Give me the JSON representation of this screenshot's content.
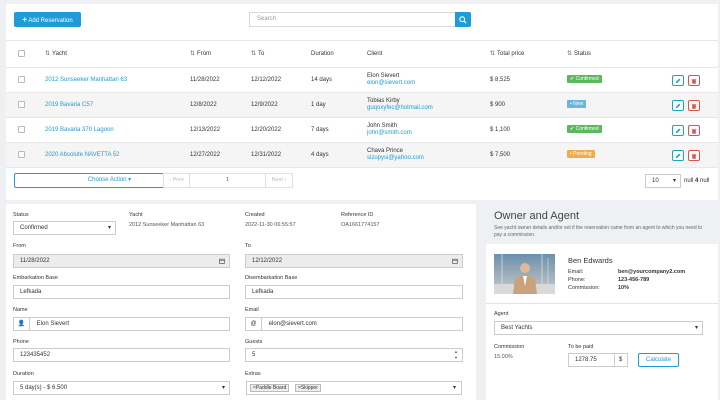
{
  "toolbar": {
    "add_label": "Add Reservation",
    "search_placeholder": "Search"
  },
  "table": {
    "headers": {
      "yacht": "Yacht",
      "from": "From",
      "to": "To",
      "duration": "Duration",
      "client": "Client",
      "total": "Total price",
      "status": "Status"
    },
    "rows": [
      {
        "yacht": "2012 Sunseeker Manhattan 63",
        "from": "11/28/2022",
        "to": "12/12/2022",
        "duration": "14 days",
        "client_name": "Elon Sievert",
        "client_email": "elon@sievert.com",
        "price": "$ 8,525",
        "status": "Confirmed",
        "status_color": "#5cb85c"
      },
      {
        "yacht": "2019 Bavaria C57",
        "from": "12/8/2022",
        "to": "12/9/2022",
        "duration": "1 day",
        "client_name": "Tobias Kirby",
        "client_email": "guqoxyfec@hotmail.com",
        "price": "$ 900",
        "status": "New",
        "status_color": "#6cb5de"
      },
      {
        "yacht": "2019 Bavaria 370 Lagoon",
        "from": "12/13/2022",
        "to": "12/20/2022",
        "duration": "7 days",
        "client_name": "John Smith",
        "client_email": "john@smith.com",
        "price": "$ 1,100",
        "status": "Confirmed",
        "status_color": "#5cb85c"
      },
      {
        "yacht": "2020 Absolute NAVETTA 52",
        "from": "12/27/2022",
        "to": "12/31/2022",
        "duration": "4 days",
        "client_name": "Chava Prince",
        "client_email": "sizupysi@yahoo.com",
        "price": "$ 7,500",
        "status": "Pending",
        "status_color": "#f0ad4e"
      }
    ]
  },
  "footer": {
    "choose_action": "Choose Action",
    "prev": "‹ Prev",
    "page": "1",
    "next": "Next ›",
    "per_page": "10",
    "info_prefix": "null",
    "info_count": "4",
    "info_suffix": "null"
  },
  "form": {
    "status_label": "Status",
    "status_value": "Confirmed",
    "yacht_label": "Yacht",
    "yacht_value": "2012 Sunseeker Manhattan 63",
    "created_label": "Created",
    "created_value": "2022-11-30 06:55:57",
    "ref_label": "Reference ID",
    "ref_value": "OA1661774157",
    "from_label": "From",
    "from_value": "11/28/2022",
    "to_label": "To",
    "to_value": "12/12/2022",
    "emb_label": "Embarkation Base",
    "emb_value": "Lefkada",
    "disemb_label": "Disembarkation Base",
    "disemb_value": "Lefkada",
    "name_label": "Name",
    "name_value": "Elon Sievert",
    "email_label": "Email",
    "email_value": "elon@sievert.com",
    "phone_label": "Phone",
    "phone_value": "123435452",
    "guests_label": "Guests",
    "guests_value": "5",
    "duration_label": "Duration",
    "duration_value": "5 day(s) - $ 6.500",
    "extras_label": "Extras",
    "extras": [
      "Paddle Board",
      "Skipper"
    ]
  },
  "owner": {
    "title": "Owner and Agent",
    "subtitle": "See yacht owner details and/or set if the reservation came from an agent to which you need to pay a commission.",
    "name": "Ben Edwards",
    "email_label": "Email:",
    "email": "ben@yourcompany2.com",
    "phone_label": "Phone:",
    "phone": "123-456-789",
    "commission_label": "Commission:",
    "commission": "10%",
    "agent_label": "Agent",
    "agent_value": "Best Yachts",
    "comm_label": "Commission",
    "comm_value": "15.00%",
    "paid_label": "To be paid",
    "paid_value": "1278.75",
    "currency": "$",
    "calc_label": "Calculate"
  },
  "colors": {
    "accent": "#1f9bd7",
    "danger": "#d9534f",
    "edit": "#1aa6b7"
  }
}
